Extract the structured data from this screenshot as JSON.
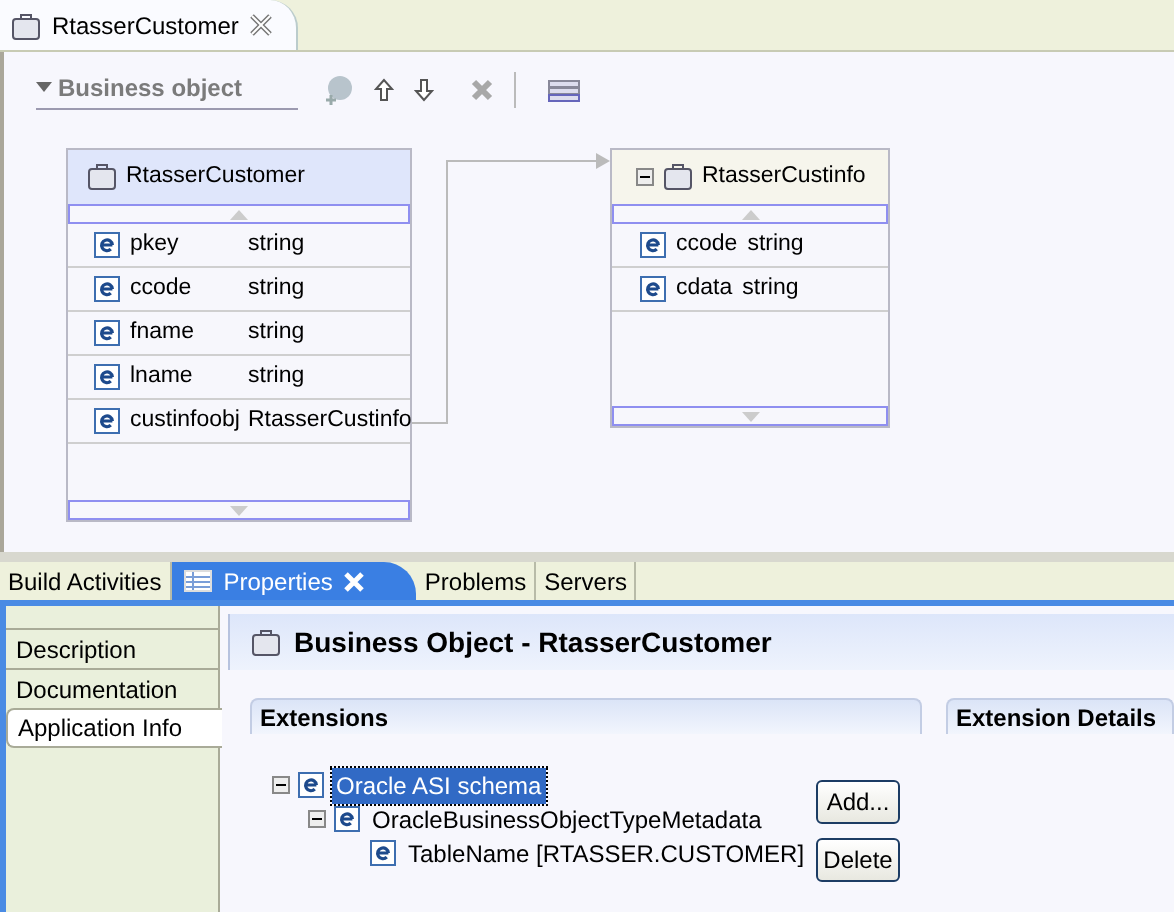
{
  "editor_tab": {
    "title": "RtasserCustomer"
  },
  "section": {
    "title": "Business object",
    "expanded": true
  },
  "diagram": {
    "objects": [
      {
        "name": "RtasserCustomer",
        "collapsible": false,
        "fields": [
          {
            "name": "pkey",
            "type": "string",
            "linked": false
          },
          {
            "name": "ccode",
            "type": "string",
            "linked": false
          },
          {
            "name": "fname",
            "type": "string",
            "linked": false
          },
          {
            "name": "lname",
            "type": "string",
            "linked": false
          },
          {
            "name": "custinfoobj",
            "type": "RtasserCustinfo",
            "linked": true
          }
        ]
      },
      {
        "name": "RtasserCustinfo",
        "collapsible": true,
        "fields": [
          {
            "name": "ccode",
            "type": "string",
            "linked": false
          },
          {
            "name": "cdata",
            "type": "string",
            "linked": false
          }
        ]
      }
    ]
  },
  "bottom_tabs": [
    {
      "label": "Build Activities",
      "selected": false
    },
    {
      "label": "Properties",
      "selected": true
    },
    {
      "label": "Problems",
      "selected": false
    },
    {
      "label": "Servers",
      "selected": false
    }
  ],
  "property_tabs": [
    {
      "label": "Description",
      "selected": false
    },
    {
      "label": "Documentation",
      "selected": false
    },
    {
      "label": "Application Info",
      "selected": true
    }
  ],
  "properties_title": "Business Object - RtasserCustomer",
  "extensions": {
    "title": "Extensions",
    "tree": [
      {
        "label": "Oracle ASI schema",
        "selected": true,
        "expanded": true,
        "children": [
          {
            "label": "OracleBusinessObjectTypeMetadata",
            "selected": false,
            "expanded": true,
            "children": [
              {
                "label": "TableName [RTASSER.CUSTOMER]",
                "selected": false
              }
            ]
          }
        ]
      }
    ],
    "buttons": [
      "Add...",
      "Delete"
    ]
  },
  "details": {
    "title": "Extension Details"
  }
}
